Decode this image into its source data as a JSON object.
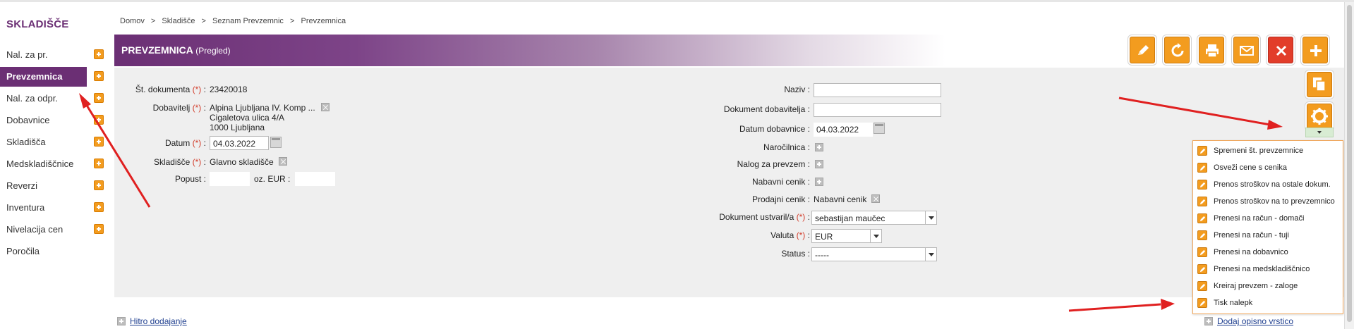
{
  "sidebar": {
    "title": "SKLADIŠČE",
    "items": [
      {
        "label": "Nal. za pr.",
        "active": false
      },
      {
        "label": "Prevzemnica",
        "active": true
      },
      {
        "label": "Nal. za odpr.",
        "active": false
      },
      {
        "label": "Dobavnice",
        "active": false
      },
      {
        "label": "Skladišča",
        "active": false
      },
      {
        "label": "Medskladiščnice",
        "active": false
      },
      {
        "label": "Reverzi",
        "active": false
      },
      {
        "label": "Inventura",
        "active": false
      },
      {
        "label": "Nivelacija cen",
        "active": false
      },
      {
        "label": "Poročila",
        "active": false
      }
    ]
  },
  "breadcrumb": [
    "Domov",
    ">",
    "Skladišče",
    ">",
    "Seznam Prevzemnic",
    ">",
    "Prevzemnica"
  ],
  "header": {
    "title": "PREVZEMNICA",
    "subtitle": "(Pregled)"
  },
  "toolbar": [
    "edit-icon",
    "refresh-icon",
    "print-icon",
    "mail-icon",
    "delete-icon",
    "add-icon"
  ],
  "form": {
    "left": {
      "st_dokumenta_label": "Št. dokumenta",
      "st_dokumenta_value": "23420018",
      "dobavitelj_label": "Dobavitelj",
      "dobavitelj_lines": [
        "Alpina Ljubljana IV. Komp ...",
        "Cigaletova ulica 4/A",
        "1000 Ljubljana"
      ],
      "datum_label": "Datum",
      "datum_value": "04.03.2022",
      "skladisce_label": "Skladišče",
      "skladisce_value": "Glavno skladišče",
      "popust_label": "Popust :",
      "oz_eur_label": "oz. EUR :",
      "req_marker": "(*)",
      "colon": ":"
    },
    "right": {
      "naziv_label": "Naziv :",
      "dokument_dobavitelja_label": "Dokument dobavitelja :",
      "datum_dobavnice_label": "Datum dobavnice :",
      "datum_dobavnice_value": "04.03.2022",
      "narocilnica_label": "Naročilnica :",
      "nalog_za_prevzem_label": "Nalog za prevzem :",
      "nabavni_cenik_label": "Nabavni cenik :",
      "prodajni_cenik_label": "Prodajni cenik :",
      "prodajni_cenik_value": "Nabavni cenik",
      "dokument_ustvaril_label": "Dokument ustvaril/a",
      "dokument_ustvaril_value": "sebastijan maučec",
      "valuta_label": "Valuta",
      "valuta_value": "EUR",
      "status_label": "Status :",
      "status_value": "-----"
    }
  },
  "action_menu": [
    "Spremeni št. prevzemnice",
    "Osveži cene s cenika",
    "Prenos stroškov na ostale dokum.",
    "Prenos stroškov na to prevzemnico",
    "Prenesi na račun - domači",
    "Prenesi na račun - tuji",
    "Prenesi na dobavnico",
    "Prenesi na medskladiščnico",
    "Kreiraj prevzem - zaloge",
    "Tisk nalepk"
  ],
  "bottom": {
    "hitro_dodajanje": "Hitro dodajanje",
    "dodaj_opisno_vrstico": "Dodaj opisno vrstico"
  },
  "colors": {
    "brand_purple": "#6b2f74",
    "orange": "#f39c1f",
    "arrow_red": "#e02020",
    "panel_bg": "#efefef"
  }
}
